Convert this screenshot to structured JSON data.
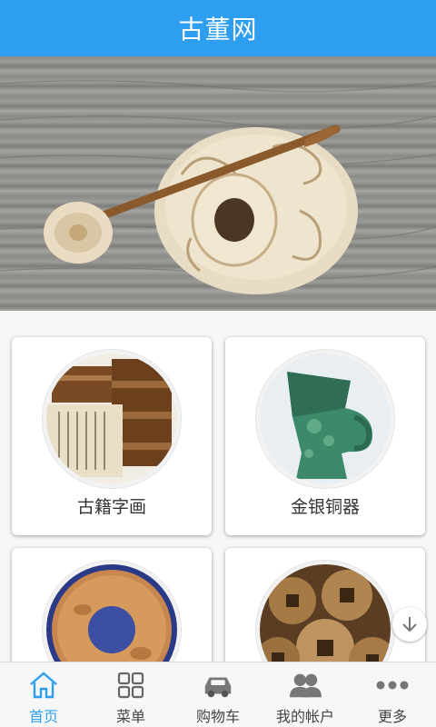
{
  "header": {
    "title": "古董网"
  },
  "banner": {
    "slides": 3,
    "active_index": 1
  },
  "categories": [
    {
      "label": "古籍字画",
      "image": "ancient-books-image"
    },
    {
      "label": "金银铜器",
      "image": "bronze-vessel-image"
    },
    {
      "label": "",
      "image": "jade-disc-image"
    },
    {
      "label": "",
      "image": "ancient-coins-image"
    }
  ],
  "tabbar": {
    "items": [
      {
        "label": "首页",
        "icon": "home-icon",
        "active": true
      },
      {
        "label": "菜单",
        "icon": "menu-grid-icon",
        "active": false
      },
      {
        "label": "购物车",
        "icon": "car-icon",
        "active": false
      },
      {
        "label": "我的帐户",
        "icon": "users-icon",
        "active": false
      },
      {
        "label": "更多",
        "icon": "more-dots-icon",
        "active": false
      }
    ]
  },
  "colors": {
    "accent": "#2e9ff0"
  }
}
